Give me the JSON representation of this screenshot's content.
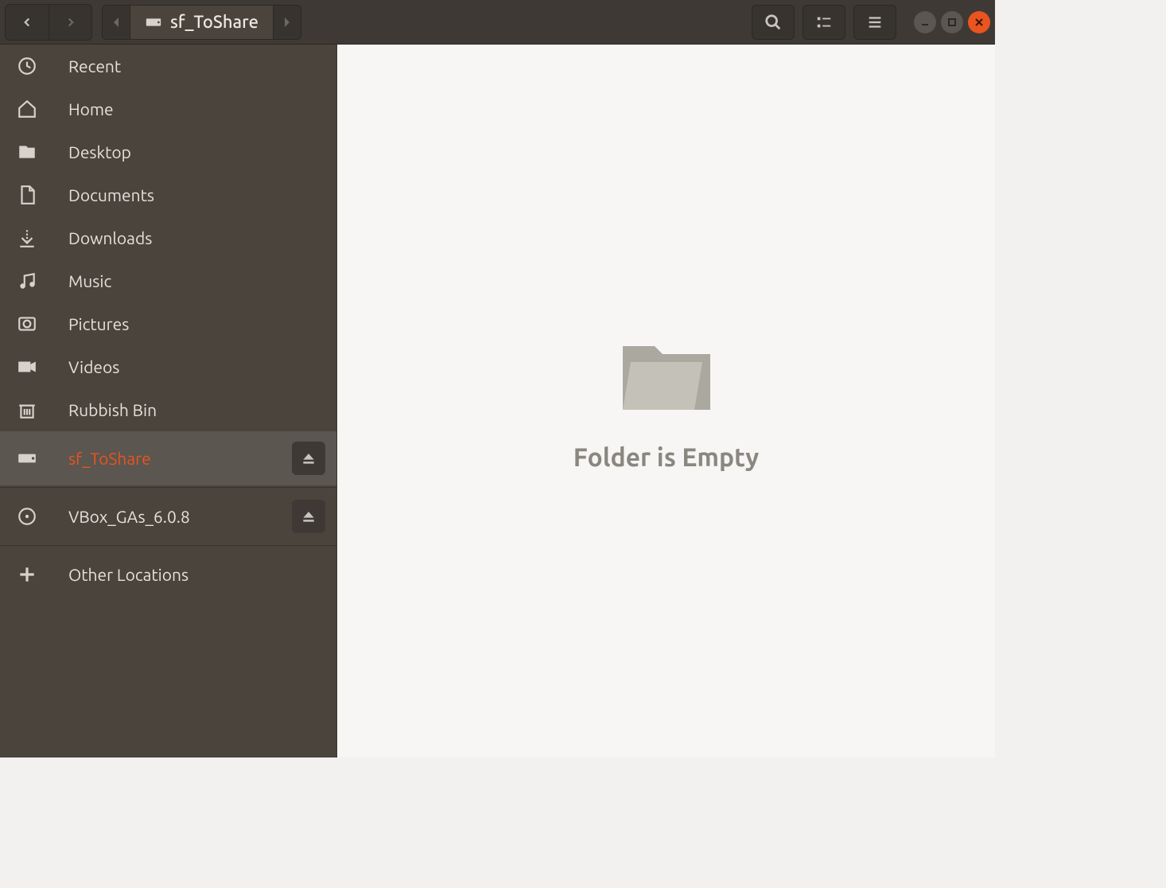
{
  "toolbar": {
    "current_location": "sf_ToShare"
  },
  "sidebar": {
    "items": [
      {
        "label": "Recent",
        "icon": "recent",
        "selected": false,
        "ejectable": false,
        "tall": false
      },
      {
        "label": "Home",
        "icon": "home",
        "selected": false,
        "ejectable": false,
        "tall": false
      },
      {
        "label": "Desktop",
        "icon": "desktop",
        "selected": false,
        "ejectable": false,
        "tall": false
      },
      {
        "label": "Documents",
        "icon": "documents",
        "selected": false,
        "ejectable": false,
        "tall": false
      },
      {
        "label": "Downloads",
        "icon": "downloads",
        "selected": false,
        "ejectable": false,
        "tall": false
      },
      {
        "label": "Music",
        "icon": "music",
        "selected": false,
        "ejectable": false,
        "tall": false
      },
      {
        "label": "Pictures",
        "icon": "pictures",
        "selected": false,
        "ejectable": false,
        "tall": false
      },
      {
        "label": "Videos",
        "icon": "videos",
        "selected": false,
        "ejectable": false,
        "tall": false
      },
      {
        "label": "Rubbish Bin",
        "icon": "trash",
        "selected": false,
        "ejectable": false,
        "tall": false
      },
      {
        "label": "sf_ToShare",
        "icon": "drive",
        "selected": true,
        "ejectable": true,
        "tall": true
      },
      {
        "label": "VBox_GAs_6.0.8",
        "icon": "disc",
        "selected": false,
        "ejectable": true,
        "tall": true
      },
      {
        "label": "Other Locations",
        "icon": "plus",
        "selected": false,
        "ejectable": false,
        "tall": true
      }
    ]
  },
  "content": {
    "empty_message": "Folder is Empty"
  }
}
